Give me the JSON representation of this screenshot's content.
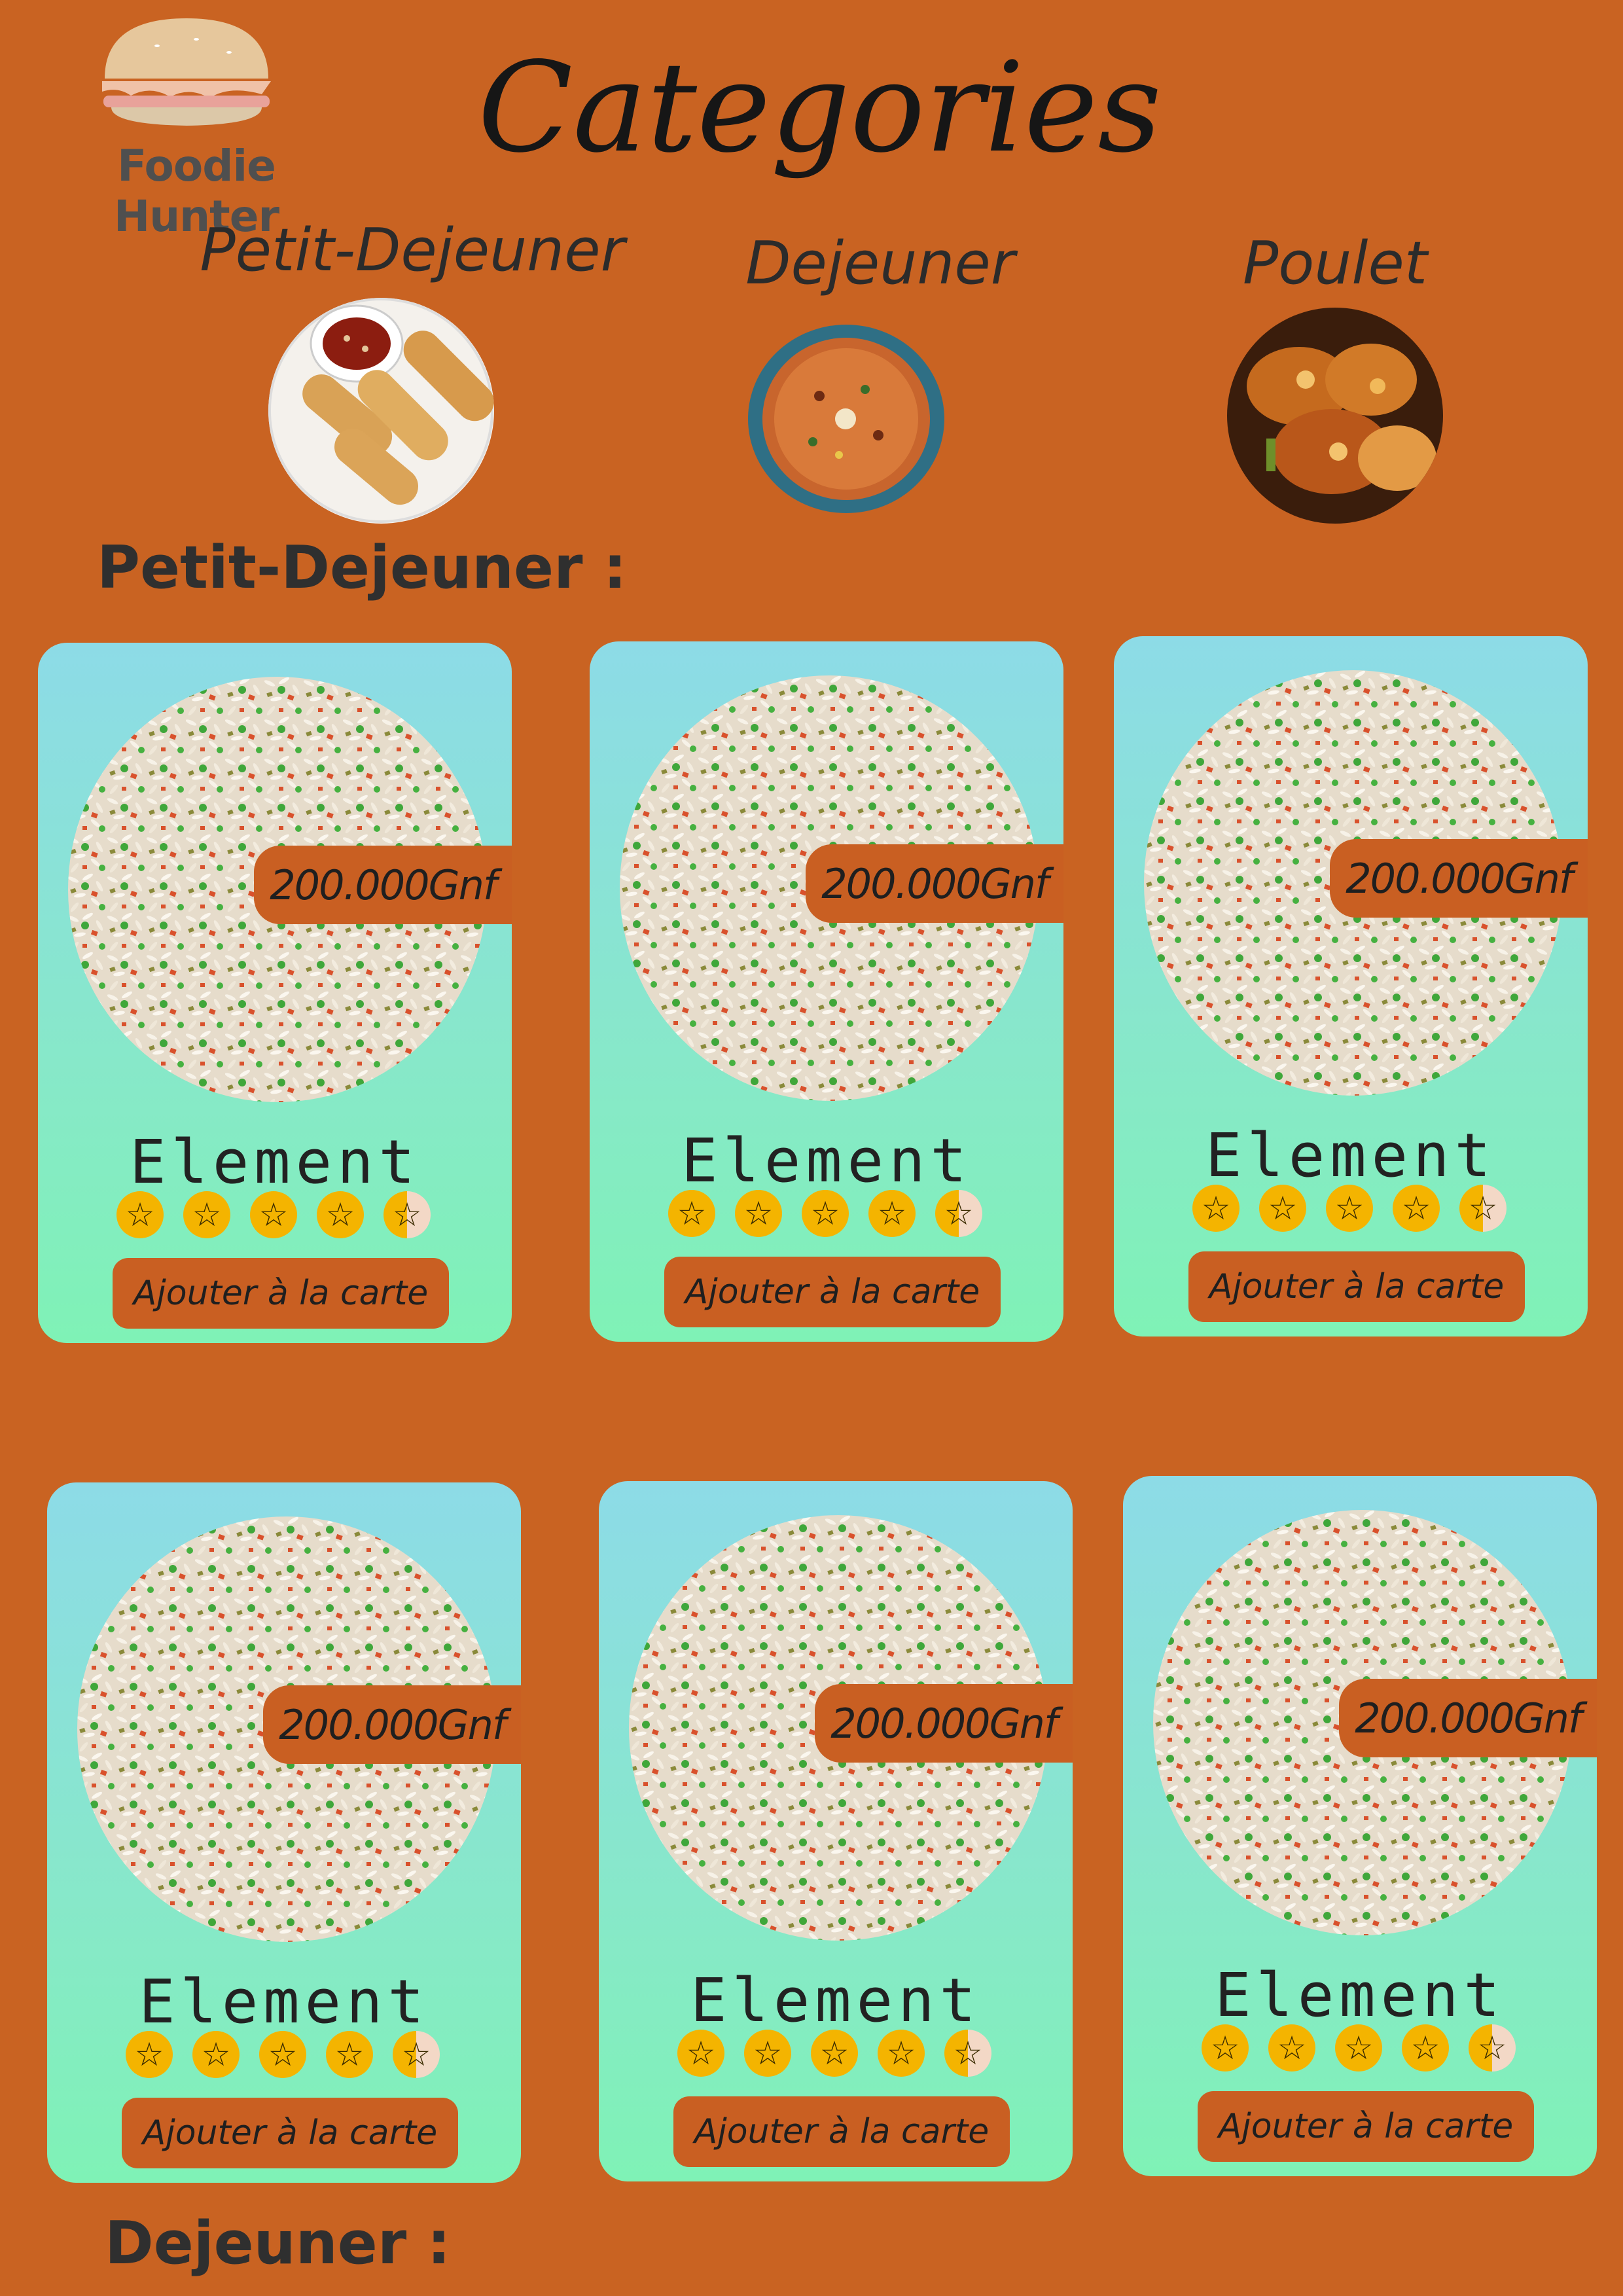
{
  "brand": {
    "name": "Foodie Hunter",
    "icon": "burger-logo-icon"
  },
  "page_title": "Categories",
  "categories": [
    {
      "label": "Petit-Dejeuner",
      "image": "spring-rolls-image"
    },
    {
      "label": "Dejeuner",
      "image": "jollof-rice-image"
    },
    {
      "label": "Poulet",
      "image": "grilled-chicken-image"
    }
  ],
  "sections": [
    {
      "heading": "Petit-Dejeuner :"
    },
    {
      "heading": "Dejeuner :"
    }
  ],
  "cards": [
    {
      "name": "Element",
      "price": "200.000Gnf",
      "rating": 4.5,
      "button": "Ajouter à la carte",
      "image": "fried-rice-image"
    },
    {
      "name": "Element",
      "price": "200.000Gnf",
      "rating": 4.5,
      "button": "Ajouter à la carte",
      "image": "fried-rice-image"
    },
    {
      "name": "Element",
      "price": "200.000Gnf",
      "rating": 4.5,
      "button": "Ajouter à la carte",
      "image": "fried-rice-image"
    },
    {
      "name": "Element",
      "price": "200.000Gnf",
      "rating": 4.5,
      "button": "Ajouter à la carte",
      "image": "fried-rice-image"
    },
    {
      "name": "Element",
      "price": "200.000Gnf",
      "rating": 4.5,
      "button": "Ajouter à la carte",
      "image": "fried-rice-image"
    },
    {
      "name": "Element",
      "price": "200.000Gnf",
      "rating": 4.5,
      "button": "Ajouter à la carte",
      "image": "fried-rice-image"
    }
  ],
  "colors": {
    "background": "#c96322",
    "accent": "#c95f22",
    "star": "#f4b400",
    "card_top": "#8ddbe7",
    "card_bottom": "#7ff2b6"
  }
}
